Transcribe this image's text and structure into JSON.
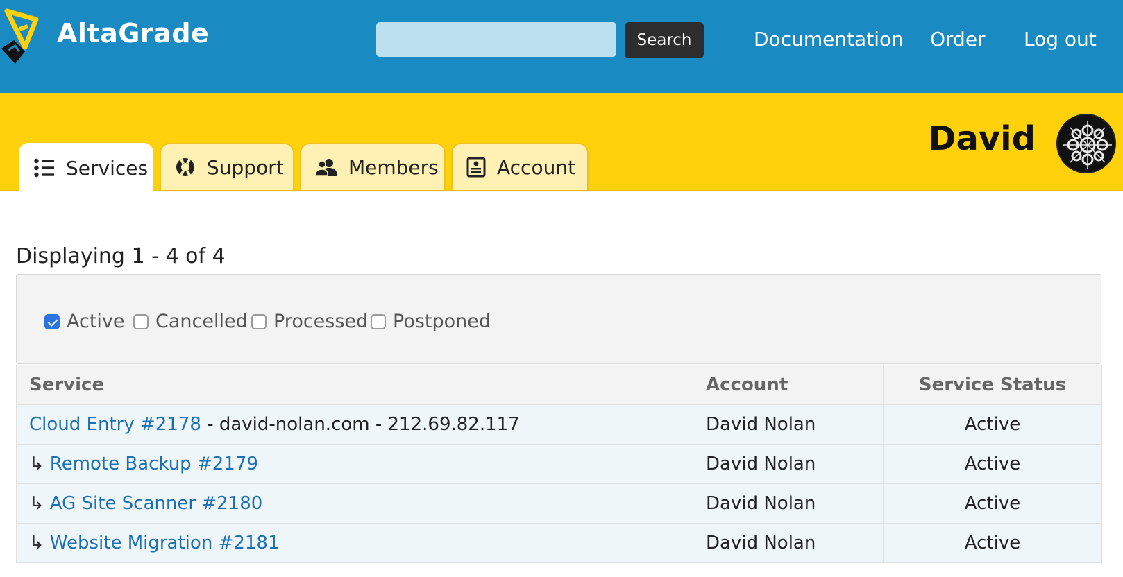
{
  "header": {
    "brand": "AltaGrade",
    "search": {
      "placeholder": "",
      "value": "",
      "button_label": "Search"
    },
    "nav": [
      "Documentation",
      "Order",
      "Log out"
    ]
  },
  "user": {
    "name": "David"
  },
  "tabs": [
    {
      "label": "Services",
      "icon": "list-icon",
      "active": true
    },
    {
      "label": "Support",
      "icon": "lifebuoy-icon",
      "active": false
    },
    {
      "label": "Members",
      "icon": "users-icon",
      "active": false
    },
    {
      "label": "Account",
      "icon": "id-card-icon",
      "active": false
    }
  ],
  "listing": {
    "count_text": "Displaying 1 - 4 of 4",
    "filters": [
      {
        "label": "Active",
        "checked": true
      },
      {
        "label": "Cancelled",
        "checked": false
      },
      {
        "label": "Processed",
        "checked": false
      },
      {
        "label": "Postponed",
        "checked": false
      }
    ],
    "columns": [
      "Service",
      "Account",
      "Service Status"
    ],
    "rows": [
      {
        "prefix": "",
        "service": "Cloud Entry #2178",
        "detail": " - david-nolan.com - 212.69.82.117",
        "account": "David Nolan",
        "status": "Active"
      },
      {
        "prefix": "↳",
        "service": "Remote Backup #2179",
        "detail": "",
        "account": "David Nolan",
        "status": "Active"
      },
      {
        "prefix": "↳",
        "service": "AG Site Scanner #2180",
        "detail": "",
        "account": "David Nolan",
        "status": "Active"
      },
      {
        "prefix": "↳",
        "service": "Website Migration #2181",
        "detail": "",
        "account": "David Nolan",
        "status": "Active"
      }
    ]
  },
  "colors": {
    "header_blue": "#1a8bc2",
    "band_yellow": "#ffd10a",
    "link_blue": "#1a6fb5",
    "checkbox_blue": "#2b74e0"
  }
}
